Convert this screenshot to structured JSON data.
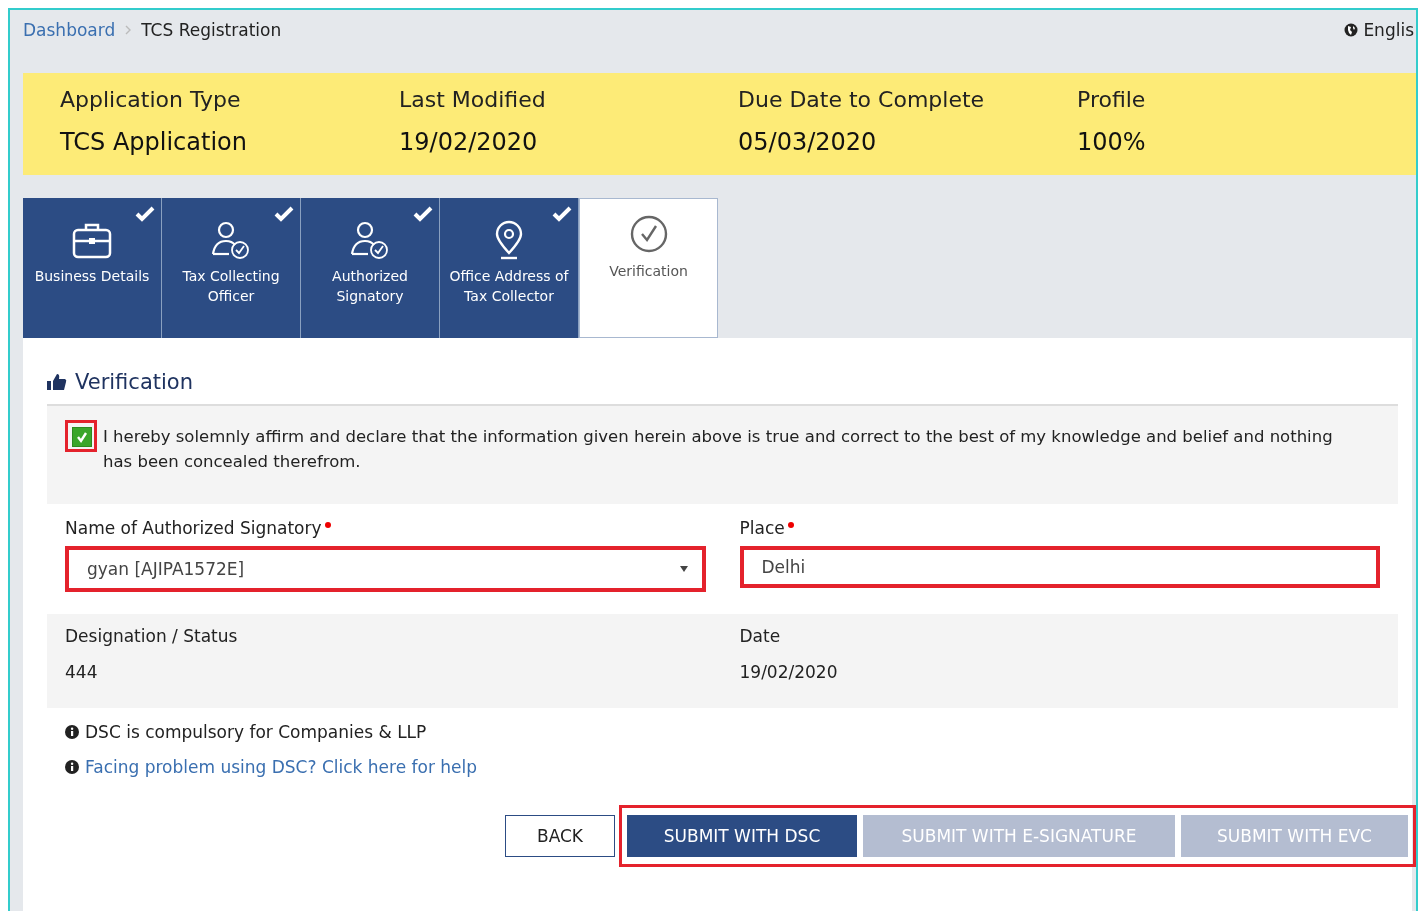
{
  "breadcrumb": [
    {
      "label": "Dashboard",
      "kind": "link"
    },
    {
      "label": "TCS Registration",
      "kind": "current"
    }
  ],
  "language": "Englis",
  "summary": [
    {
      "label": "Application Type",
      "value": "TCS Application"
    },
    {
      "label": "Last Modified",
      "value": "19/02/2020"
    },
    {
      "label": "Due Date to Complete",
      "value": "05/03/2020"
    },
    {
      "label": "Profile",
      "value": "100%"
    }
  ],
  "steps": [
    {
      "label": "Business Details",
      "kind": "business",
      "completed": true,
      "selected": false
    },
    {
      "label": "Tax Collecting Officer",
      "kind": "person",
      "completed": true,
      "selected": false
    },
    {
      "label": "Authorized Signatory",
      "kind": "person",
      "completed": true,
      "selected": false
    },
    {
      "label": "Office Address of Tax Collector",
      "kind": "address",
      "completed": true,
      "selected": false
    },
    {
      "label": "Verification",
      "kind": "verification",
      "completed": false,
      "selected": true
    }
  ],
  "section_title": "Verification",
  "declaration": {
    "checked": true,
    "highlighted": true,
    "text": "I hereby solemnly affirm and declare that the information given herein above is true and correct to the best of my knowledge and belief and nothing has been concealed therefrom."
  },
  "fields": [
    {
      "label": "Name of Authorized Signatory",
      "kind": "select",
      "value": "gyan [AJIPA1572E]",
      "required": true,
      "highlighted": true
    },
    {
      "label": "Place",
      "kind": "text",
      "value": "Delhi",
      "required": true,
      "highlighted": true
    }
  ],
  "info": [
    {
      "label": "Designation / Status",
      "value": "444"
    },
    {
      "label": "Date",
      "value": "19/02/2020"
    }
  ],
  "notes": [
    {
      "text": "DSC is compulsory for Companies & LLP",
      "kind": "text"
    },
    {
      "text": "Facing problem using DSC? Click here for help",
      "kind": "link"
    }
  ],
  "buttons": [
    {
      "label": "BACK",
      "kind": "outline"
    },
    {
      "label": "SUBMIT WITH DSC",
      "kind": "primary",
      "disabled": false
    },
    {
      "label": "SUBMIT WITH E-SIGNATURE",
      "kind": "primary",
      "disabled": true
    },
    {
      "label": "SUBMIT WITH EVC",
      "kind": "primary",
      "disabled": true
    }
  ],
  "submit_group_highlighted": true
}
